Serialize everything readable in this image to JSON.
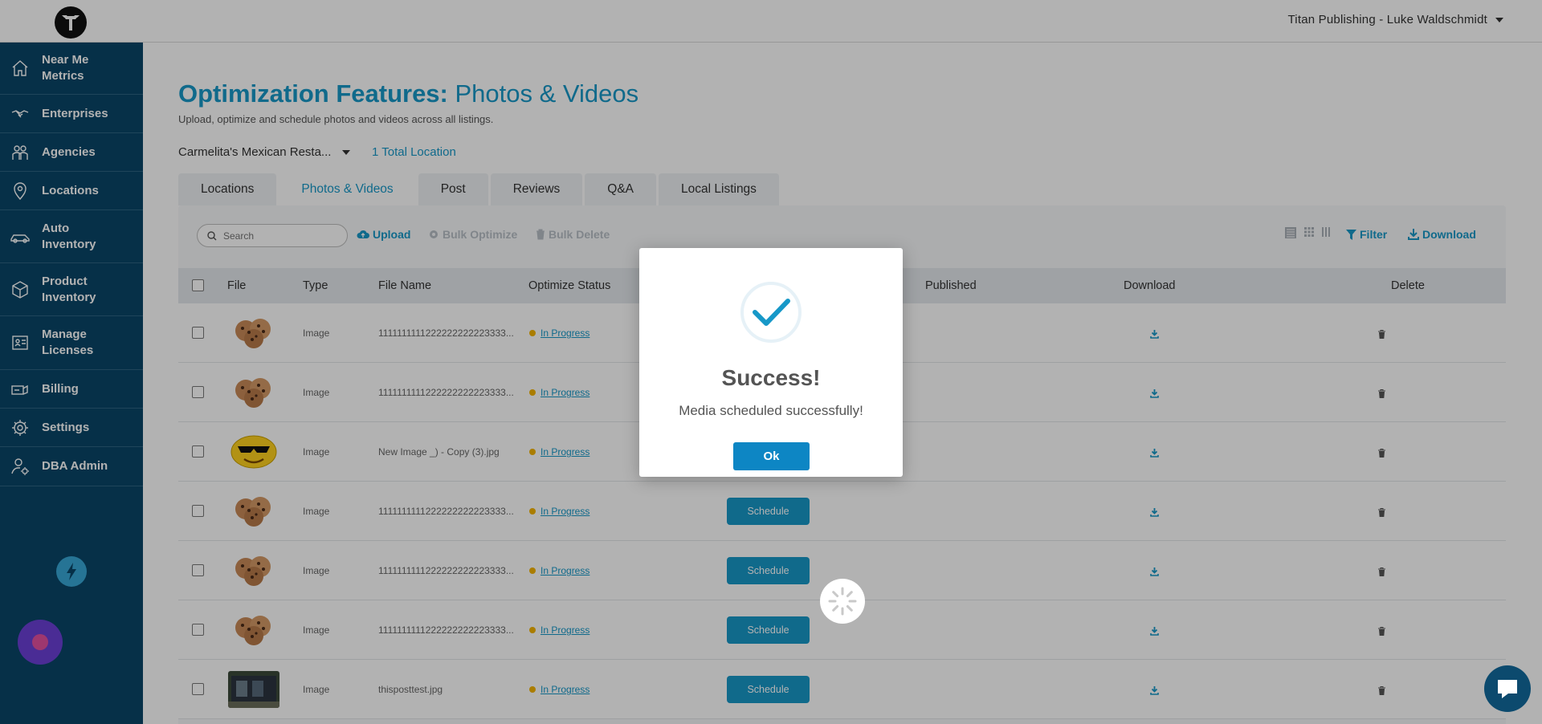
{
  "header": {
    "account_name": "Titan Publishing - Luke Waldschmidt"
  },
  "sidebar": {
    "items": [
      {
        "label": "Near Me Metrics",
        "icon": "home-icon"
      },
      {
        "label": "Enterprises",
        "icon": "handshake-icon"
      },
      {
        "label": "Agencies",
        "icon": "people-icon"
      },
      {
        "label": "Locations",
        "icon": "map-pin-icon"
      },
      {
        "label": "Auto Inventory",
        "icon": "car-icon"
      },
      {
        "label": "Product Inventory",
        "icon": "box-icon"
      },
      {
        "label": "Manage Licenses",
        "icon": "license-icon"
      },
      {
        "label": "Billing",
        "icon": "billing-icon"
      },
      {
        "label": "Settings",
        "icon": "gear-icon"
      },
      {
        "label": "DBA Admin",
        "icon": "admin-icon"
      }
    ]
  },
  "page": {
    "title_bold": "Optimization Features:",
    "title_light": " Photos & Videos",
    "subtitle": "Upload, optimize and schedule photos and videos across all listings.",
    "location_selected": "Carmelita's Mexican Resta...",
    "location_count": "1 Total Location"
  },
  "tabs": [
    "Locations",
    "Photos & Videos",
    "Post",
    "Reviews",
    "Q&A",
    "Local Listings"
  ],
  "active_tab": "Photos & Videos",
  "toolbar": {
    "search_placeholder": "Search",
    "upload": "Upload",
    "bulk_optimize": "Bulk Optimize",
    "bulk_delete": "Bulk Delete",
    "filter": "Filter",
    "download": "Download"
  },
  "table": {
    "columns": [
      "File",
      "Type",
      "File Name",
      "Optimize Status",
      "Published",
      "Download",
      "Delete"
    ],
    "rows": [
      {
        "thumb": "cookies",
        "type": "Image",
        "file_name": "1111111111222222222223333...",
        "status": "In Progress",
        "show_schedule": false
      },
      {
        "thumb": "cookies",
        "type": "Image",
        "file_name": "1111111111222222222223333...",
        "status": "In Progress",
        "show_schedule": false
      },
      {
        "thumb": "smiley",
        "type": "Image",
        "file_name": "New Image _) - Copy (3).jpg",
        "status": "In Progress",
        "show_schedule": false
      },
      {
        "thumb": "cookies",
        "type": "Image",
        "file_name": "1111111111222222222223333...",
        "status": "In Progress",
        "show_schedule": true
      },
      {
        "thumb": "cookies",
        "type": "Image",
        "file_name": "1111111111222222222223333...",
        "status": "In Progress",
        "show_schedule": true
      },
      {
        "thumb": "cookies",
        "type": "Image",
        "file_name": "1111111111222222222223333...",
        "status": "In Progress",
        "show_schedule": true
      },
      {
        "thumb": "building",
        "type": "Image",
        "file_name": "thisposttest.jpg",
        "status": "In Progress",
        "show_schedule": true
      }
    ],
    "schedule_label": "Schedule"
  },
  "modal": {
    "title": "Success!",
    "message": "Media scheduled successfully!",
    "ok_label": "Ok"
  },
  "colors": {
    "accent": "#1798c8",
    "sidebar": "#0a4668",
    "status_in_progress": "#f4b400"
  }
}
